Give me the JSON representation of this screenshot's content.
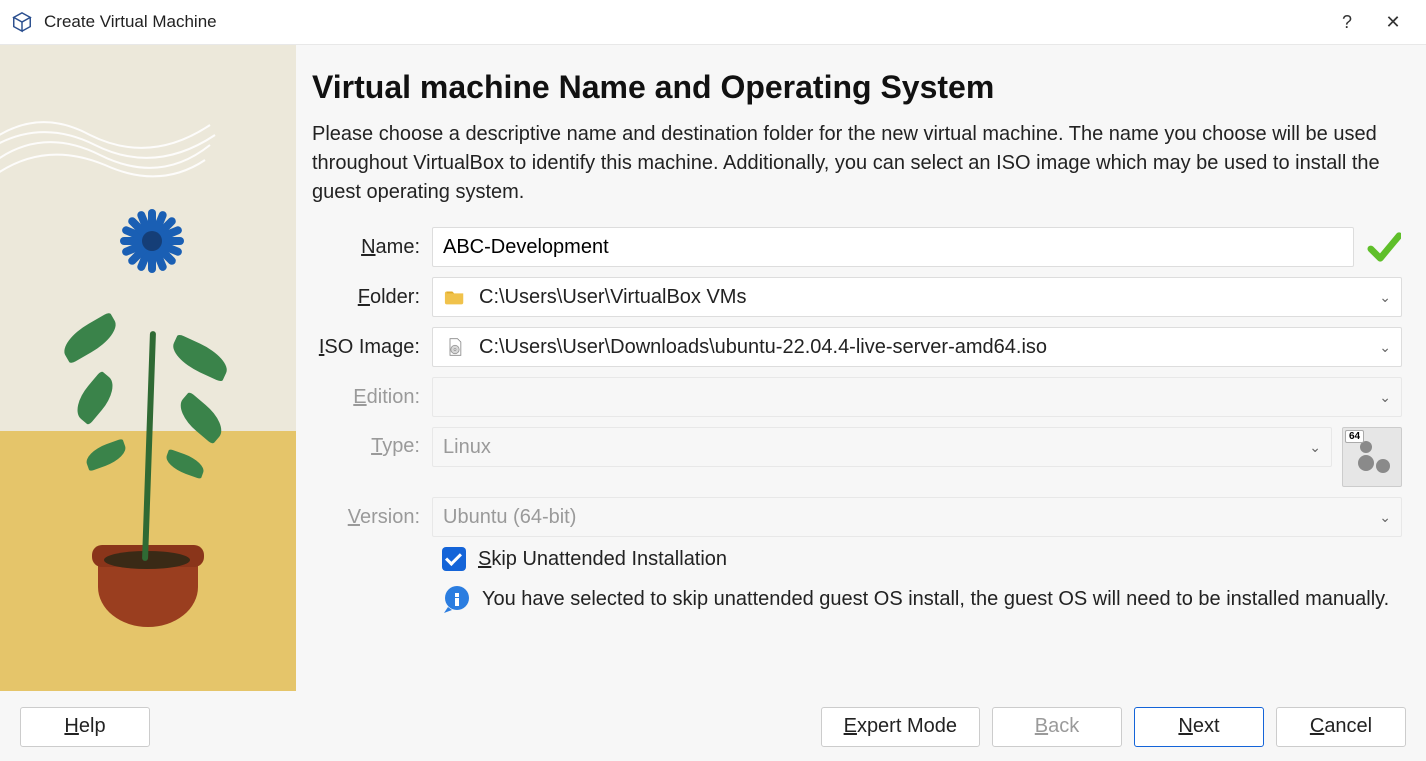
{
  "window": {
    "title": "Create Virtual Machine",
    "help_symbol": "?",
    "close_symbol": "✕"
  },
  "heading": "Virtual machine Name and Operating System",
  "description": "Please choose a descriptive name and destination folder for the new virtual machine. The name you choose will be used throughout VirtualBox to identify this machine. Additionally, you can select an ISO image which may be used to install the guest operating system.",
  "labels": {
    "name_prefix": "N",
    "name_rest": "ame:",
    "folder_prefix": "F",
    "folder_rest": "older:",
    "iso_prefix": "I",
    "iso_rest": "SO Image:",
    "edition_prefix": "E",
    "edition_rest": "dition:",
    "type_prefix": "T",
    "type_rest": "ype:",
    "version_prefix": "V",
    "version_rest": "ersion:"
  },
  "fields": {
    "name": "ABC-Development",
    "folder": "C:\\Users\\User\\VirtualBox VMs",
    "iso": "C:\\Users\\User\\Downloads\\ubuntu-22.04.4-live-server-amd64.iso",
    "edition": "",
    "type": "Linux",
    "version": "Ubuntu (64-bit)",
    "os_bits": "64"
  },
  "checkbox": {
    "prefix": "S",
    "rest": "kip Unattended Installation",
    "checked": true
  },
  "info_text": "You have selected to skip unattended guest OS install, the guest OS will need to be installed manually.",
  "buttons": {
    "help_prefix": "H",
    "help_rest": "elp",
    "expert_prefix": "E",
    "expert_rest": "xpert Mode",
    "back_prefix": "B",
    "back_rest": "ack",
    "next_prefix": "N",
    "next_rest": "ext",
    "cancel_prefix": "C",
    "cancel_rest": "ancel"
  }
}
